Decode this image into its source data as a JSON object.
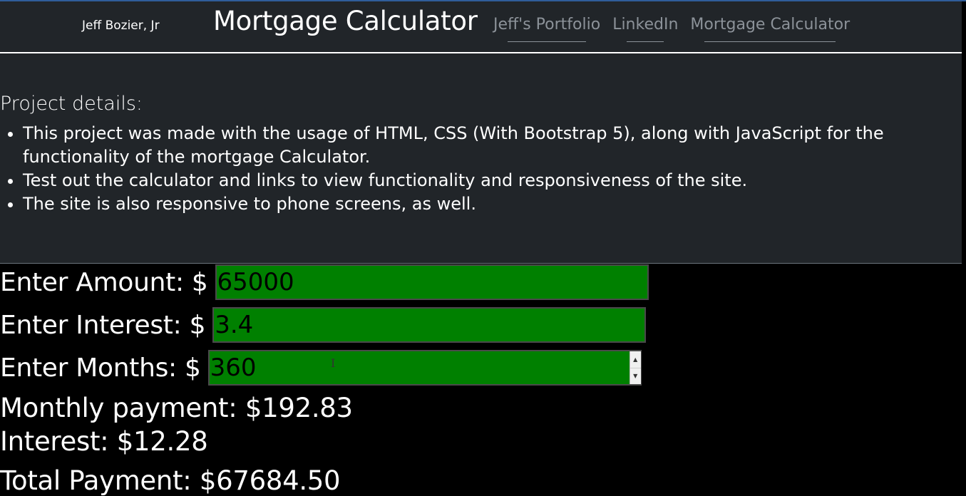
{
  "nav": {
    "brand": "Jeff Bozier, Jr",
    "title": "Mortgage Calculator",
    "links": [
      {
        "label": "Jeff's Portfolio"
      },
      {
        "label": "LinkedIn"
      },
      {
        "label": "Mortgage Calculator"
      }
    ]
  },
  "details": {
    "heading": "Project details:",
    "items": [
      "This project was made with the usage of HTML, CSS (With Bootstrap 5), along with JavaScript for the functionality of the mortgage Calculator.",
      "Test out the calculator and links to view functionality and responsiveness of the site.",
      "The site is also responsive to phone screens, as well."
    ]
  },
  "form": {
    "amount_label": "Enter Amount: $",
    "amount_value": "65000",
    "interest_label": "Enter Interest: $",
    "interest_value": "3.4",
    "months_label": "Enter Months: $",
    "months_value": "360"
  },
  "results": {
    "monthly": "Monthly payment: $192.83",
    "interest": "Interest: $12.28",
    "total": "Total Payment: $67684.50"
  },
  "colors": {
    "navbar_bg": "#212529",
    "input_bg": "#008000",
    "page_bg": "#000000",
    "nav_link": "#8c9299"
  },
  "icons": {
    "cursor": "text-cursor-icon",
    "spin_up": "triangle-up-icon",
    "spin_down": "triangle-down-icon"
  }
}
